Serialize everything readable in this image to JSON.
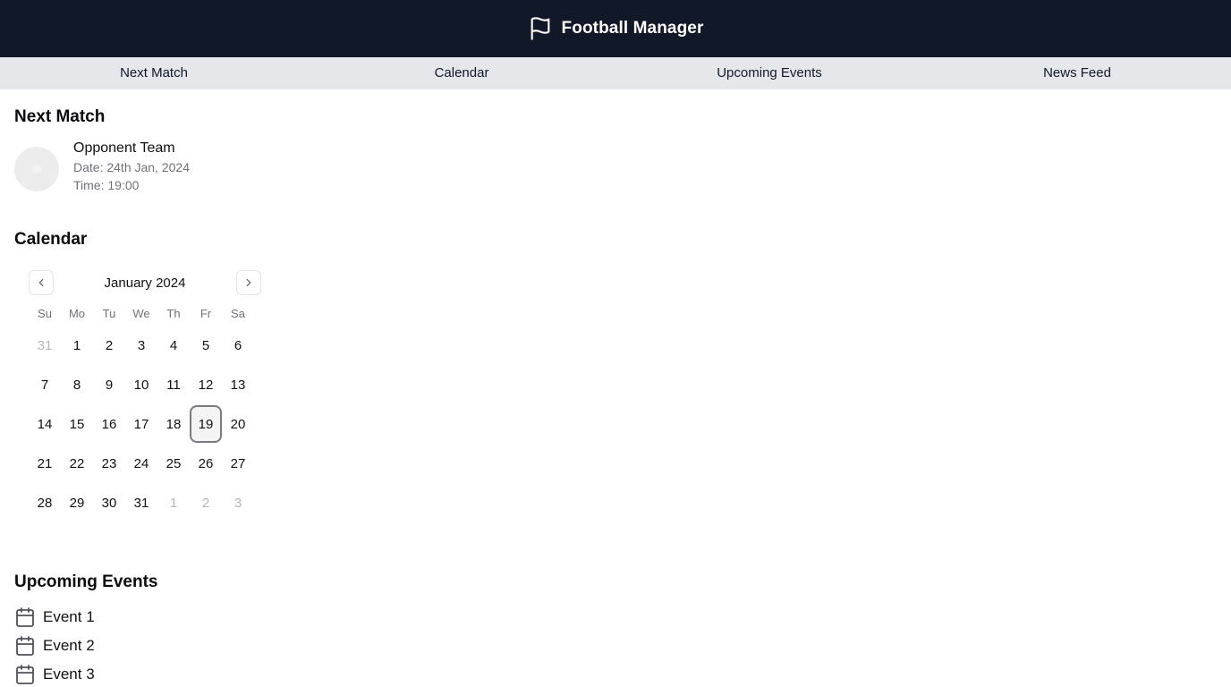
{
  "header": {
    "title": "Football Manager",
    "icon": "flag-icon"
  },
  "nav": {
    "tabs": [
      {
        "label": "Next Match"
      },
      {
        "label": "Calendar"
      },
      {
        "label": "Upcoming Events"
      },
      {
        "label": "News Feed"
      }
    ]
  },
  "next_match": {
    "title": "Next Match",
    "team": "Opponent Team",
    "date": "Date: 24th Jan, 2024",
    "time": "Time: 19:00"
  },
  "calendar": {
    "title": "Calendar",
    "month": "January 2024",
    "weekdays": [
      "Su",
      "Mo",
      "Tu",
      "We",
      "Th",
      "Fr",
      "Sa"
    ],
    "days": [
      "31",
      "1",
      "2",
      "3",
      "4",
      "5",
      "6",
      "7",
      "8",
      "9",
      "10",
      "11",
      "12",
      "13",
      "14",
      "15",
      "16",
      "17",
      "18",
      "19",
      "20",
      "21",
      "22",
      "23",
      "24",
      "25",
      "26",
      "27",
      "28",
      "29",
      "30",
      "31",
      "1",
      "2",
      "3"
    ],
    "muted_indices": [
      0,
      32,
      33,
      34
    ],
    "selected_index": 19
  },
  "events": {
    "title": "Upcoming Events",
    "items": [
      {
        "label": "Event 1"
      },
      {
        "label": "Event 2"
      },
      {
        "label": "Event 3"
      }
    ]
  },
  "colors": {
    "header_bg": "#111827",
    "nav_bg": "#e5e7eb",
    "muted_text": "#71717a"
  }
}
